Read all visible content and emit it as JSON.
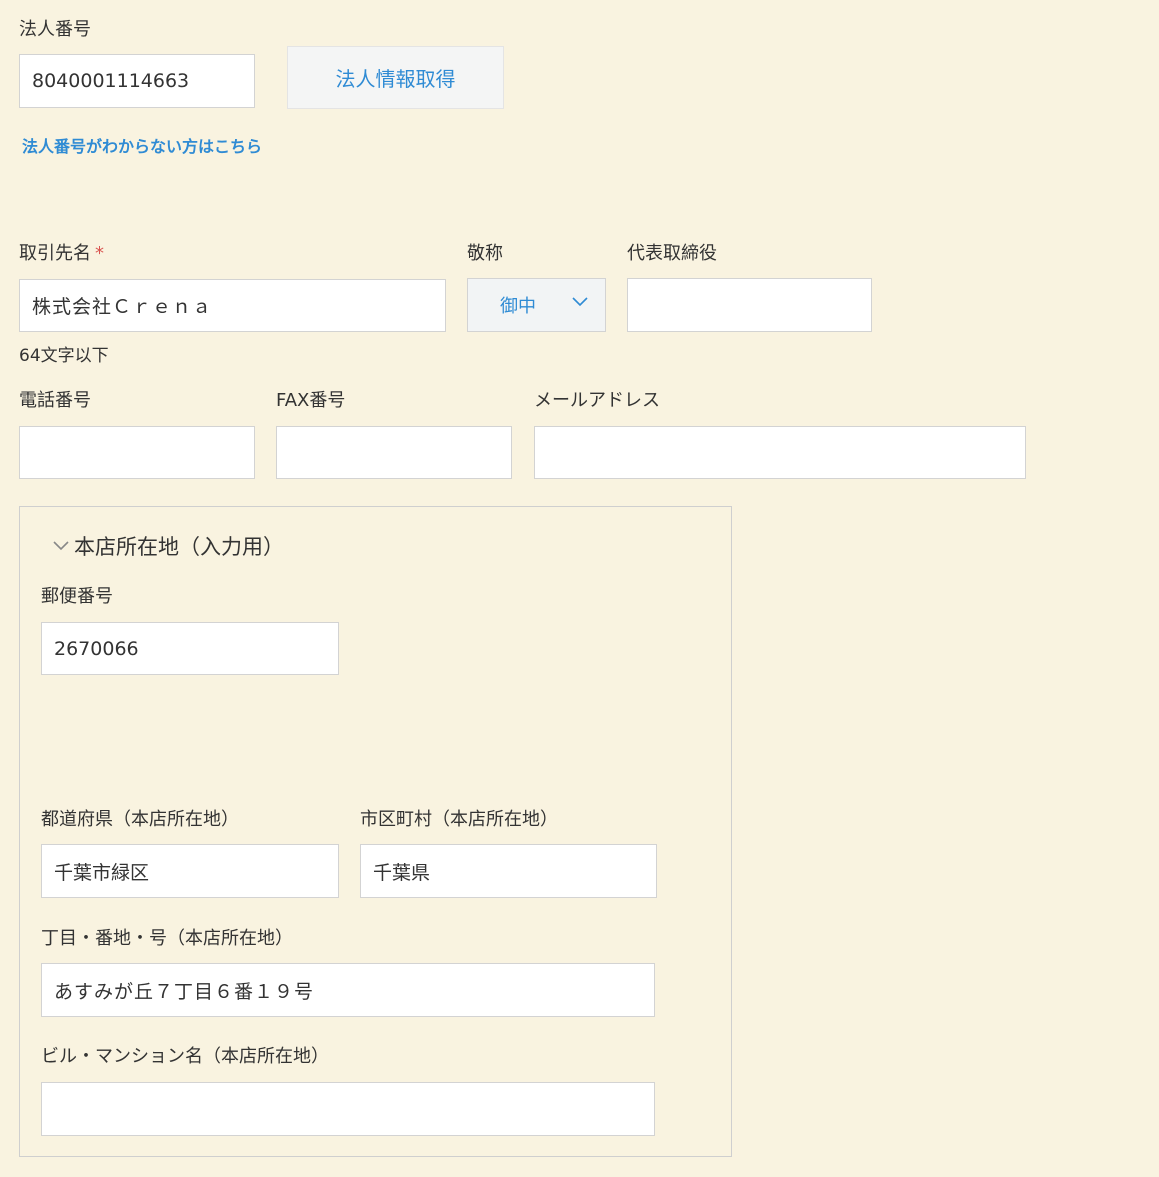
{
  "corporate_number": {
    "label": "法人番号",
    "value": "8040001114663",
    "fetch_button": "法人情報取得",
    "help_link": "法人番号がわからない方はこちら"
  },
  "partner_name": {
    "label": "取引先名",
    "required_mark": "*",
    "value": "株式会社Ｃｒｅｎａ",
    "note": "64文字以下"
  },
  "honorific": {
    "label": "敬称",
    "value": "御中"
  },
  "representative": {
    "label": "代表取締役",
    "value": ""
  },
  "phone": {
    "label": "電話番号",
    "value": ""
  },
  "fax": {
    "label": "FAX番号",
    "value": ""
  },
  "email": {
    "label": "メールアドレス",
    "value": ""
  },
  "head_office": {
    "title": "本店所在地（入力用）",
    "postal_code": {
      "label": "郵便番号",
      "value": "2670066"
    },
    "prefecture": {
      "label": "都道府県（本店所在地）",
      "value": "千葉市緑区"
    },
    "city": {
      "label": "市区町村（本店所在地）",
      "value": "千葉県"
    },
    "street": {
      "label": "丁目・番地・号（本店所在地）",
      "value": "あすみが丘７丁目６番１９号"
    },
    "building": {
      "label": "ビル・マンション名（本店所在地）",
      "value": ""
    }
  }
}
